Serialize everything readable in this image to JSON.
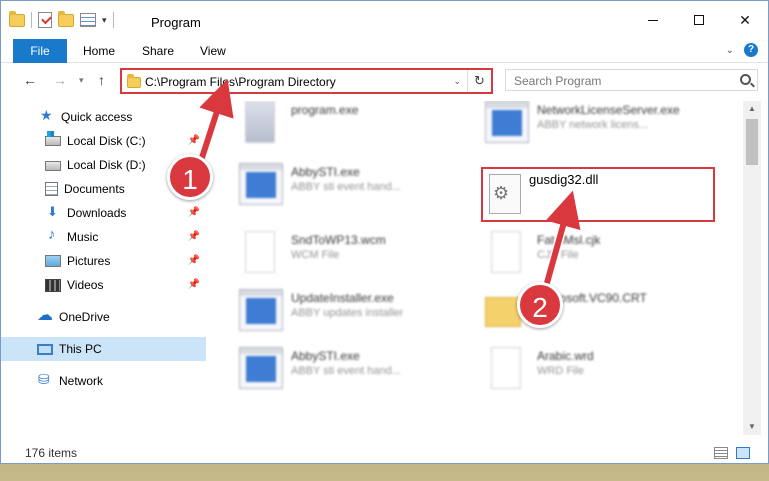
{
  "window": {
    "title": "Program",
    "controls": {
      "minimize": "",
      "maximize": "",
      "close": "✕"
    }
  },
  "ribbon": {
    "tabs": [
      "File",
      "Home",
      "Share",
      "View"
    ],
    "help": "?"
  },
  "address": {
    "path": "C:\\Program Files\\Program Directory",
    "search_placeholder": "Search Program"
  },
  "sidebar": {
    "items": [
      {
        "label": "Quick access",
        "icon": "star-icon"
      },
      {
        "label": "Local Disk (C:)",
        "icon": "drive-icon"
      },
      {
        "label": "Local Disk (D:)",
        "icon": "drive-icon"
      },
      {
        "label": "Documents",
        "icon": "documents-icon"
      },
      {
        "label": "Downloads",
        "icon": "downloads-icon"
      },
      {
        "label": "Music",
        "icon": "music-icon"
      },
      {
        "label": "Pictures",
        "icon": "pictures-icon"
      },
      {
        "label": "Videos",
        "icon": "videos-icon"
      },
      {
        "label": "OneDrive",
        "icon": "cloud-icon"
      },
      {
        "label": "This PC",
        "icon": "computer-icon"
      },
      {
        "label": "Network",
        "icon": "network-icon"
      }
    ]
  },
  "files": [
    {
      "name": "program.exe",
      "desc": ""
    },
    {
      "name": "NetworkLicenseServer.exe",
      "desc": "ABBY network licens..."
    },
    {
      "name": "AbbySTI.exe",
      "desc": "ABBY sti event hand..."
    },
    {
      "name": "gusdig32.dll",
      "desc": ""
    },
    {
      "name": "SndToWP13.wcm",
      "desc": "WCM File"
    },
    {
      "name": "FatalMsl.cjk",
      "desc": "CJK File"
    },
    {
      "name": "UpdateInstaller.exe",
      "desc": "ABBY updates installer"
    },
    {
      "name": "Microsoft.VC90.CRT",
      "desc": ""
    },
    {
      "name": "AbbySTI.exe",
      "desc": "ABBY sti event hand..."
    },
    {
      "name": "Arabic.wrd",
      "desc": "WRD File"
    }
  ],
  "status": {
    "count": "176 items"
  },
  "annotations": {
    "step1": "1",
    "step2": "2"
  },
  "colors": {
    "accent": "#1979ca",
    "highlight": "#d9383f",
    "selected": "#cce4f7"
  }
}
